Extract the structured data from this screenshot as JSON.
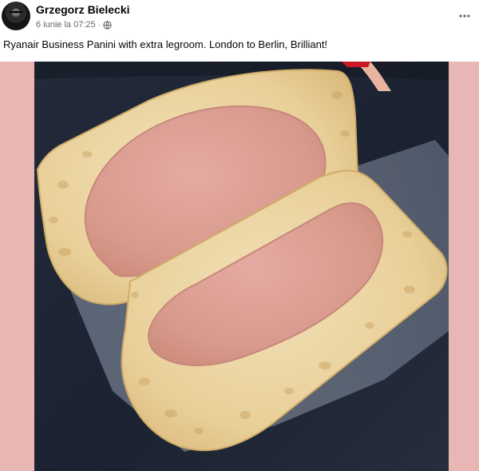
{
  "post": {
    "author": "Grzegorz Bielecki",
    "timestamp": "6 iunie la 07:25",
    "separator": "·",
    "privacy_icon": "globe-icon",
    "more_icon": "more-options-icon",
    "text": "Ryanair Business Panini with extra legroom. London to Berlin, Brilliant!"
  },
  "photo": {
    "subject": "panini-photo"
  },
  "colors": {
    "photo_side_background": "#e9b7b3",
    "author_text": "#050505",
    "meta_text": "#65676b"
  }
}
